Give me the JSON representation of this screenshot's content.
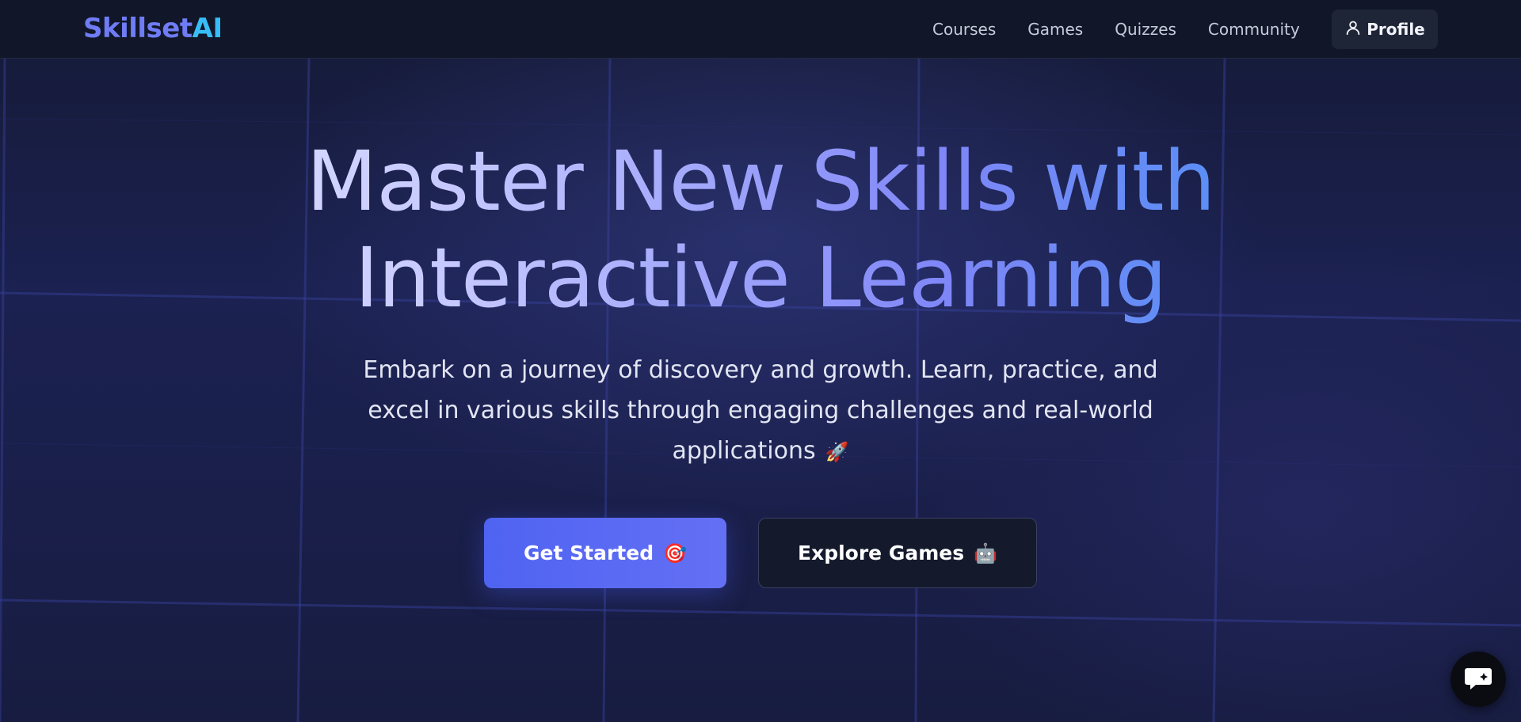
{
  "brand": {
    "part1": "Skillset",
    "part2": "AI"
  },
  "nav": {
    "items": [
      {
        "label": "Courses"
      },
      {
        "label": "Games"
      },
      {
        "label": "Quizzes"
      },
      {
        "label": "Community"
      }
    ],
    "profile_label": "Profile"
  },
  "hero": {
    "title_line1": "Master New Skills with",
    "title_line2": "Interactive Learning",
    "subtitle": "Embark on a journey of discovery and growth. Learn, practice, and excel in various skills through engaging challenges and real-world applications",
    "subtitle_emoji": "🚀",
    "primary_cta": "Get Started",
    "primary_emoji": "🎯",
    "secondary_cta": "Explore Games",
    "secondary_emoji": "🤖"
  },
  "chat": {
    "icon": "chat-bubble-sparkle-icon"
  },
  "colors": {
    "brand_purple": "#6f7cf5",
    "brand_blue": "#38bdf8",
    "primary_button": "#5468f3",
    "header_bg": "#111728"
  }
}
